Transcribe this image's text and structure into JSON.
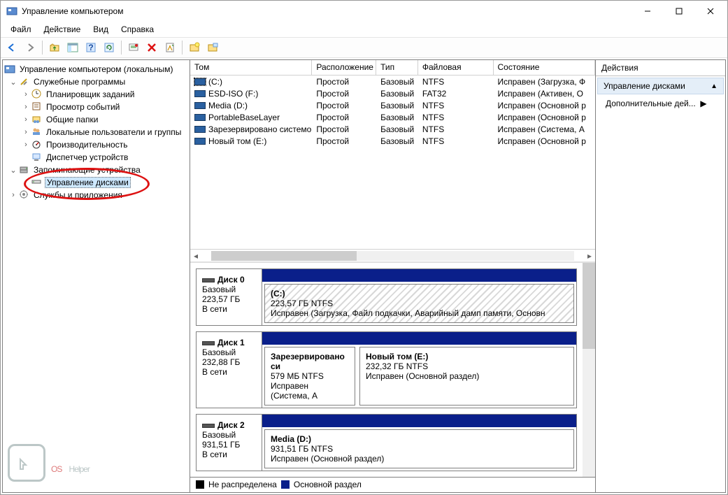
{
  "window": {
    "title": "Управление компьютером"
  },
  "menus": {
    "file": "Файл",
    "action": "Действие",
    "view": "Вид",
    "help": "Справка"
  },
  "tree": {
    "root": "Управление компьютером (локальным)",
    "tools": "Служебные программы",
    "tools_items": {
      "scheduler": "Планировщик заданий",
      "events": "Просмотр событий",
      "shared": "Общие папки",
      "users": "Локальные пользователи и группы",
      "perf": "Производительность",
      "devmgr": "Диспетчер устройств"
    },
    "storage": "Запоминающие устройства",
    "diskmgmt": "Управление дисками",
    "services": "Службы и приложения"
  },
  "columns": {
    "vol": "Том",
    "layout": "Расположение",
    "type": "Тип",
    "fs": "Файловая система",
    "status": "Состояние"
  },
  "volumes": [
    {
      "name": "(C:)",
      "layout": "Простой",
      "type": "Базовый",
      "fs": "NTFS",
      "status": "Исправен (Загрузка, Ф"
    },
    {
      "name": "ESD-ISO (F:)",
      "layout": "Простой",
      "type": "Базовый",
      "fs": "FAT32",
      "status": "Исправен (Активен, О"
    },
    {
      "name": "Media (D:)",
      "layout": "Простой",
      "type": "Базовый",
      "fs": "NTFS",
      "status": "Исправен (Основной р"
    },
    {
      "name": "PortableBaseLayer",
      "layout": "Простой",
      "type": "Базовый",
      "fs": "NTFS",
      "status": "Исправен (Основной р"
    },
    {
      "name": "Зарезервировано системой",
      "layout": "Простой",
      "type": "Базовый",
      "fs": "NTFS",
      "status": "Исправен (Система, А"
    },
    {
      "name": "Новый том (E:)",
      "layout": "Простой",
      "type": "Базовый",
      "fs": "NTFS",
      "status": "Исправен (Основной р"
    }
  ],
  "disks": [
    {
      "title": "Диск 0",
      "kind": "Базовый",
      "size": "223,57 ГБ",
      "online": "В сети",
      "parts": [
        {
          "name": "(C:)",
          "line2": "223,57 ГБ NTFS",
          "status": "Исправен (Загрузка, Файл подкачки, Аварийный дамп памяти, Основн",
          "hatch": true,
          "fill": true
        }
      ]
    },
    {
      "title": "Диск 1",
      "kind": "Базовый",
      "size": "232,88 ГБ",
      "online": "В сети",
      "parts": [
        {
          "name": "Зарезервировано си",
          "line2": "579 МБ NTFS",
          "status": "Исправен (Система, А",
          "fill": false,
          "w": 130
        },
        {
          "name": "Новый том  (E:)",
          "line2": "232,32 ГБ NTFS",
          "status": "Исправен (Основной раздел)",
          "fill": true
        }
      ]
    },
    {
      "title": "Диск 2",
      "kind": "Базовый",
      "size": "931,51 ГБ",
      "online": "В сети",
      "parts": [
        {
          "name": "Media  (D:)",
          "line2": "931,51 ГБ NTFS",
          "status": "Исправен (Основной раздел)",
          "fill": true
        }
      ]
    }
  ],
  "legend": {
    "unalloc": "Не распределена",
    "primary": "Основной раздел"
  },
  "actions": {
    "head": "Действия",
    "title": "Управление дисками",
    "more": "Дополнительные дей..."
  }
}
